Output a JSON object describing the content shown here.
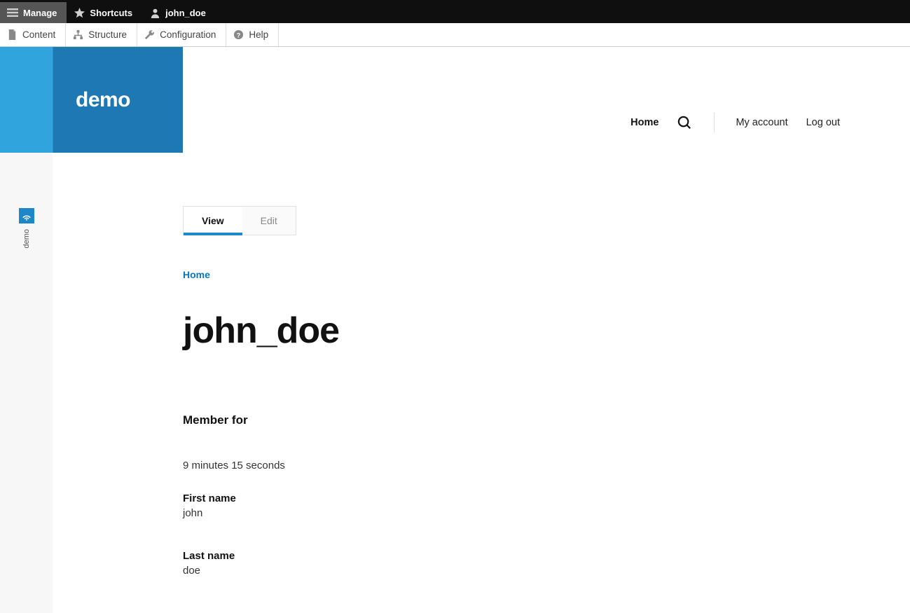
{
  "toolbar_top": {
    "manage": "Manage",
    "shortcuts": "Shortcuts",
    "user": "john_doe"
  },
  "toolbar_sub": {
    "content": "Content",
    "structure": "Structure",
    "configuration": "Configuration",
    "help": "Help"
  },
  "sidebar": {
    "vertical_tab_label": "demo"
  },
  "logo": {
    "text": "demo"
  },
  "topnav": {
    "home": "Home",
    "my_account": "My account",
    "log_out": "Log out"
  },
  "tabs": {
    "view": "View",
    "edit": "Edit"
  },
  "breadcrumb": {
    "home": "Home"
  },
  "page": {
    "title": "john_doe"
  },
  "profile": {
    "member_for_label": "Member for",
    "member_for_value": "9 minutes 15 seconds",
    "first_name_label": "First name",
    "first_name_value": "john",
    "last_name_label": "Last name",
    "last_name_value": "doe"
  }
}
